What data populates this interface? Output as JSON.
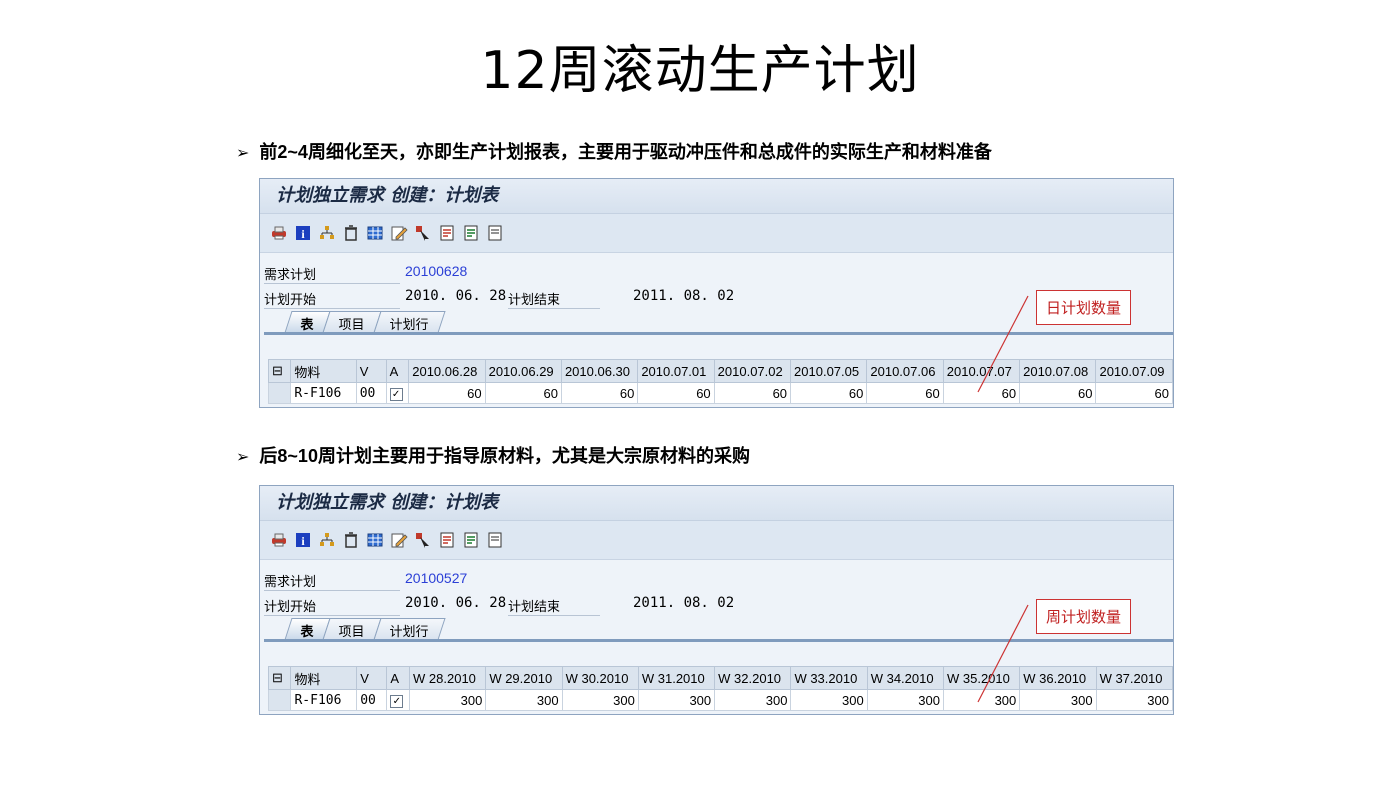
{
  "slide": {
    "title": "12周滚动生产计划",
    "bullet1": "前2~4周细化至天，亦即生产计划报表，主要用于驱动冲压件和总成件的实际生产和材料准备",
    "bullet2": "后8~10周计划主要用于指导原材料，尤其是大宗原材料的采购"
  },
  "panels": [
    {
      "title": "计划独立需求 创建：计划表",
      "toolbar_icons": [
        "print-icon",
        "info-icon",
        "hierarchy-icon",
        "trash-icon",
        "table-icon",
        "edit-icon",
        "select-icon",
        "doc-icon",
        "doc2-icon",
        "doc3-icon"
      ],
      "plan_label": "需求计划",
      "plan_value": "20100628",
      "start_label": "计划开始",
      "start_value": "2010. 06. 28",
      "end_label": "计划结束",
      "end_value": "2011. 08. 02",
      "tabs": [
        "表",
        "项目",
        "计划行"
      ],
      "columns": [
        "物料",
        "V",
        "A",
        "2010.06.28",
        "2010.06.29",
        "2010.06.30",
        "2010.07.01",
        "2010.07.02",
        "2010.07.05",
        "2010.07.06",
        "2010.07.07",
        "2010.07.08",
        "2010.07.09"
      ],
      "row": {
        "material": "R-F106",
        "v": "00",
        "a_checked": true,
        "values": [
          "60",
          "60",
          "60",
          "60",
          "60",
          "60",
          "60",
          "60",
          "60",
          "60"
        ]
      },
      "callout": "日计划数量"
    },
    {
      "title": "计划独立需求 创建：计划表",
      "toolbar_icons": [
        "print-icon",
        "info-icon",
        "hierarchy-icon",
        "trash-icon",
        "table-icon",
        "edit-icon",
        "select-icon",
        "doc-icon",
        "doc2-icon",
        "doc3-icon"
      ],
      "plan_label": "需求计划",
      "plan_value": "20100527",
      "start_label": "计划开始",
      "start_value": "2010. 06. 28",
      "end_label": "计划结束",
      "end_value": "2011. 08. 02",
      "tabs": [
        "表",
        "项目",
        "计划行"
      ],
      "columns": [
        "物料",
        "V",
        "A",
        "W 28.2010",
        "W 29.2010",
        "W 30.2010",
        "W 31.2010",
        "W 32.2010",
        "W 33.2010",
        "W 34.2010",
        "W 35.2010",
        "W 36.2010",
        "W 37.2010"
      ],
      "row": {
        "material": "R-F106",
        "v": "00",
        "a_checked": true,
        "values": [
          "300",
          "300",
          "300",
          "300",
          "300",
          "300",
          "300",
          "300",
          "300",
          "300"
        ]
      },
      "callout": "周计划数量"
    }
  ],
  "colors": {
    "callout": "#cc3333",
    "link": "#2b3fd6",
    "panel_border": "#8ea4c0"
  }
}
